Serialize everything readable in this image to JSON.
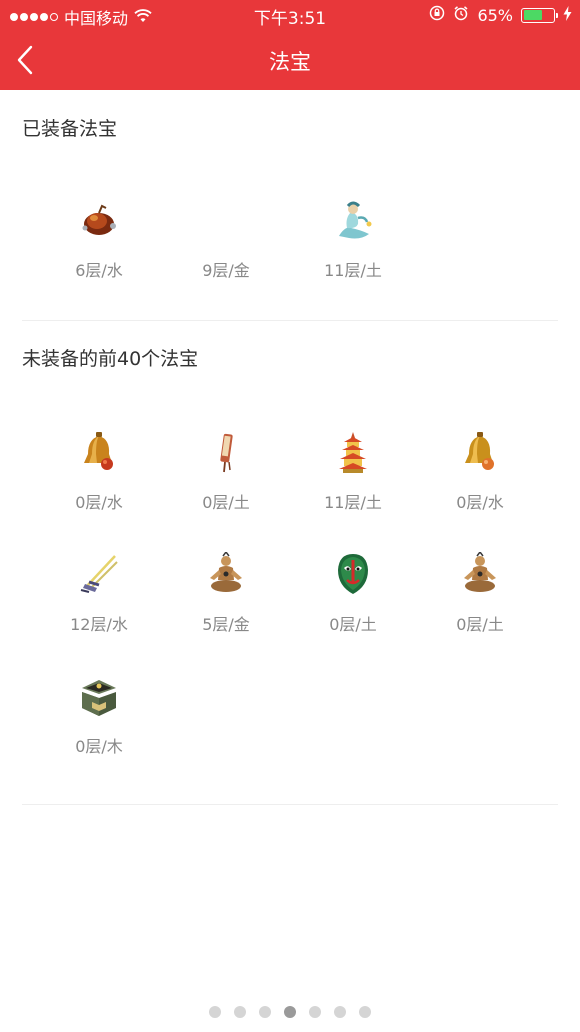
{
  "status_bar": {
    "carrier": "中国移动",
    "time": "下午3:51",
    "battery": "65%",
    "battery_level": 0.65
  },
  "nav": {
    "title": "法宝",
    "back_icon": "chevron-left-icon"
  },
  "equipped": {
    "title": "已装备法宝",
    "items": [
      {
        "label": "6层/水",
        "icon": "gourd-icon"
      },
      {
        "label": "9层/金",
        "icon": ""
      },
      {
        "label": "11层/土",
        "icon": "spirit-figure-icon"
      }
    ]
  },
  "unequipped": {
    "title": "未装备的前40个法宝",
    "items": [
      {
        "label": "0层/水",
        "icon": "bell-icon"
      },
      {
        "label": "0层/土",
        "icon": "scroll-icon"
      },
      {
        "label": "11层/土",
        "icon": "pagoda-icon"
      },
      {
        "label": "0层/水",
        "icon": "bell-icon"
      },
      {
        "label": "12层/水",
        "icon": "flying-sword-icon"
      },
      {
        "label": "5层/金",
        "icon": "meditating-figure-icon"
      },
      {
        "label": "0层/土",
        "icon": "opera-mask-icon"
      },
      {
        "label": "0层/土",
        "icon": "meditating-figure-icon"
      },
      {
        "label": "0层/木",
        "icon": "treasure-chest-icon"
      }
    ]
  },
  "pager": {
    "count": 7,
    "active_index": 3
  },
  "colors": {
    "header": "#e8373a",
    "battery_fill": "#4cd964"
  }
}
